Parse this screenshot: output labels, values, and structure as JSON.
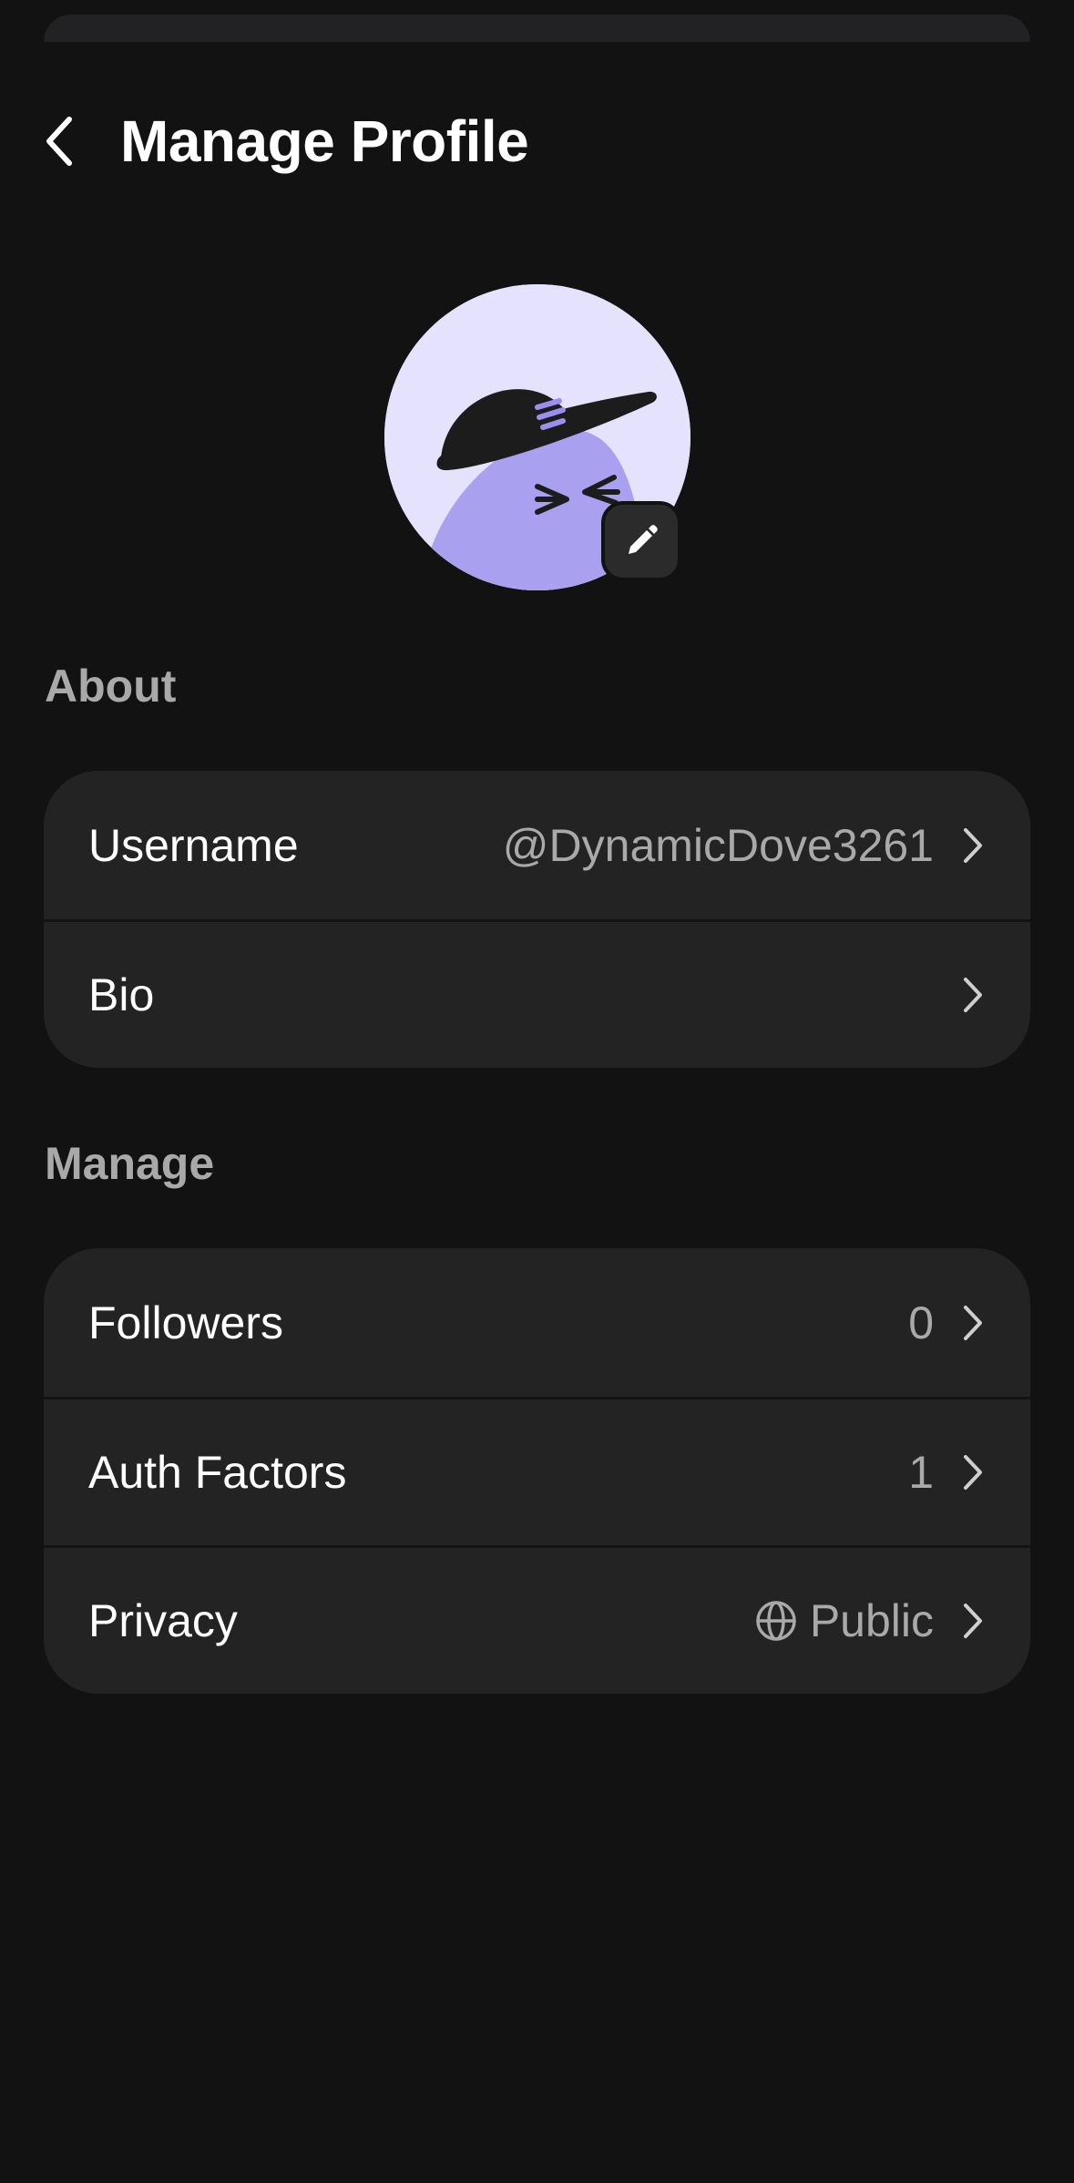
{
  "header": {
    "title": "Manage Profile",
    "back_icon": "chevron-left-icon"
  },
  "avatar": {
    "description_icon": "avatar-bird-with-hat",
    "edit_icon": "pencil-icon",
    "colors": {
      "background": "#e4e2fc",
      "body": "#a9a0ef",
      "hat": "#1c1c1c"
    }
  },
  "about": {
    "section_label": "About",
    "rows": [
      {
        "label": "Username",
        "value": "@DynamicDove3261"
      },
      {
        "label": "Bio",
        "value": ""
      }
    ]
  },
  "manage": {
    "section_label": "Manage",
    "rows": [
      {
        "label": "Followers",
        "value": "0"
      },
      {
        "label": "Auth Factors",
        "value": "1"
      },
      {
        "label": "Privacy",
        "value": "Public",
        "icon": "globe-icon"
      }
    ]
  },
  "colors": {
    "background": "#121212",
    "card": "#232323",
    "muted_text": "#a9a9a9"
  }
}
